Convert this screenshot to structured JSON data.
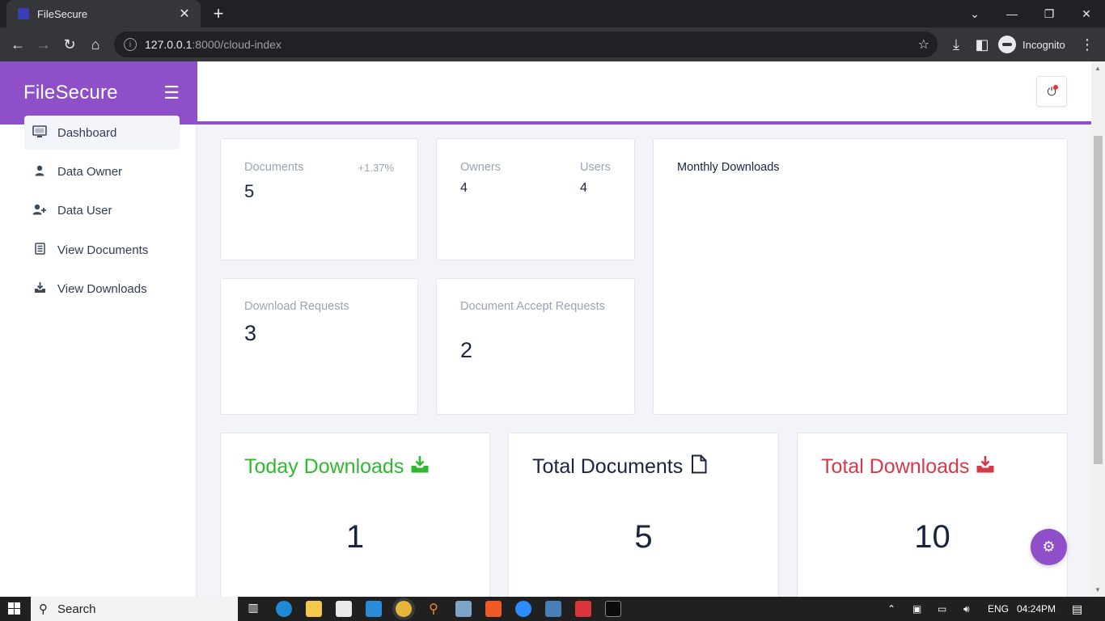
{
  "browser": {
    "tab_title": "FileSecure",
    "tab_close": "✕",
    "new_tab": "+",
    "url_host": "127.0.0.1",
    "url_rest": ":8000/cloud-index",
    "profile_label": "Incognito"
  },
  "app": {
    "brand": "FileSecure",
    "menu_icon": "☰"
  },
  "sidebar": {
    "items": [
      {
        "label": "Dashboard",
        "icon": "monitor-icon",
        "glyph": "▭"
      },
      {
        "label": "Data Owner",
        "icon": "user-icon",
        "glyph": "●"
      },
      {
        "label": "Data User",
        "icon": "user-plus-icon",
        "glyph": "●+"
      },
      {
        "label": "View Documents",
        "icon": "list-icon",
        "glyph": "☰"
      },
      {
        "label": "View Downloads",
        "icon": "download-tray-icon",
        "glyph": "⤓"
      }
    ]
  },
  "stats": {
    "documents": {
      "label": "Documents",
      "value": "5",
      "change": "+1.37%"
    },
    "owners": {
      "label": "Owners",
      "value": "4"
    },
    "users": {
      "label": "Users",
      "value": "4"
    },
    "download_requests": {
      "label": "Download Requests",
      "value": "3"
    },
    "accept_requests": {
      "label": "Document Accept Requests",
      "value": "2"
    },
    "monthly_downloads": {
      "label": "Monthly Downloads"
    }
  },
  "summary": {
    "today": {
      "label": "Today Downloads",
      "value": "1",
      "color": "#2fb92f"
    },
    "total_documents": {
      "label": "Total Documents",
      "value": "5",
      "color": "#1a2440"
    },
    "total_downloads": {
      "label": "Total Downloads",
      "value": "10",
      "color": "#d63a4a"
    }
  },
  "taskbar": {
    "search_label": "Search",
    "language": "ENG",
    "time": "04:24PM"
  }
}
